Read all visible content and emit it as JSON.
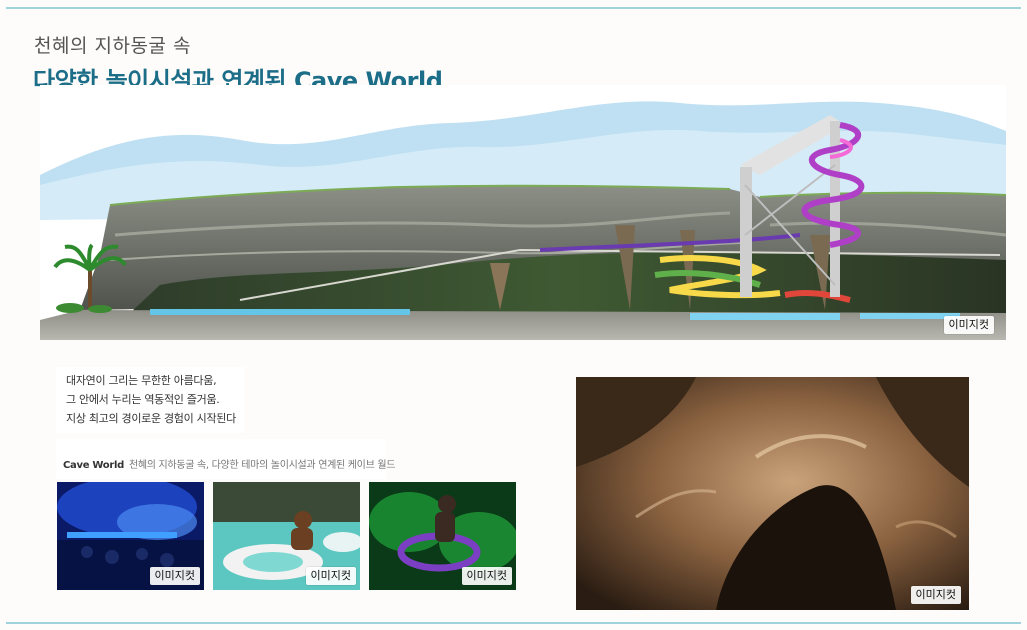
{
  "header": {
    "subtitle": "천혜의 지하동굴 속",
    "title": "다양한 놀이시설과 연계된 Cave World"
  },
  "hero": {
    "badge": "이미지컷"
  },
  "intro": {
    "lines": [
      "대자연이 그리는 무한한 아름다움,",
      "그 안에서 누리는 역동적인 즐거움.",
      "지상 최고의 경이로운 경험이 시작된다"
    ]
  },
  "caption": {
    "name": "Cave World",
    "text": "천혜의 지하동굴 속, 다양한 테마의 놀이시설과 연계된 케이브 월드"
  },
  "thumbnails": [
    {
      "badge": "이미지컷"
    },
    {
      "badge": "이미지컷"
    },
    {
      "badge": "이미지컷"
    }
  ],
  "photo": {
    "badge": "이미지컷"
  },
  "colors": {
    "title": "#1c6d88",
    "rule": "#9fd3dc",
    "sky": "#bfe0f2",
    "rock": "#6f7369"
  }
}
